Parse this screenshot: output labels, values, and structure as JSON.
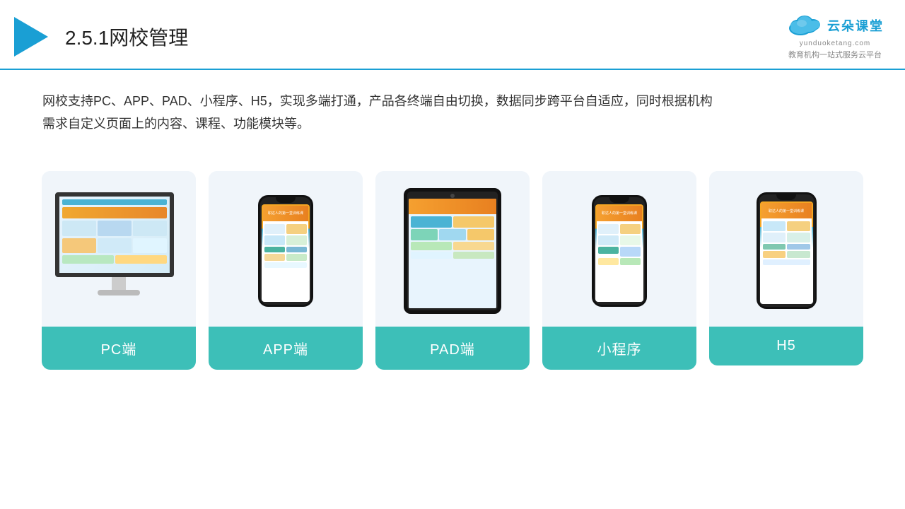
{
  "header": {
    "section_number": "2.5.1",
    "title": "网校管理",
    "logo_cn": "云朵课堂",
    "logo_en": "yunduoketang.com",
    "logo_slogan": "教育机构一站\n式服务云平台"
  },
  "description": {
    "text_line1": "网校支持PC、APP、PAD、小程序、H5，实现多端打通，产品各终端自由切换，数据同步跨平台自适应，同时根据机构",
    "text_line2": "需求自定义页面上的内容、课程、功能模块等。"
  },
  "cards": [
    {
      "id": "pc",
      "label": "PC端"
    },
    {
      "id": "app",
      "label": "APP端"
    },
    {
      "id": "pad",
      "label": "PAD端"
    },
    {
      "id": "miniprogram",
      "label": "小程序"
    },
    {
      "id": "h5",
      "label": "H5"
    }
  ]
}
